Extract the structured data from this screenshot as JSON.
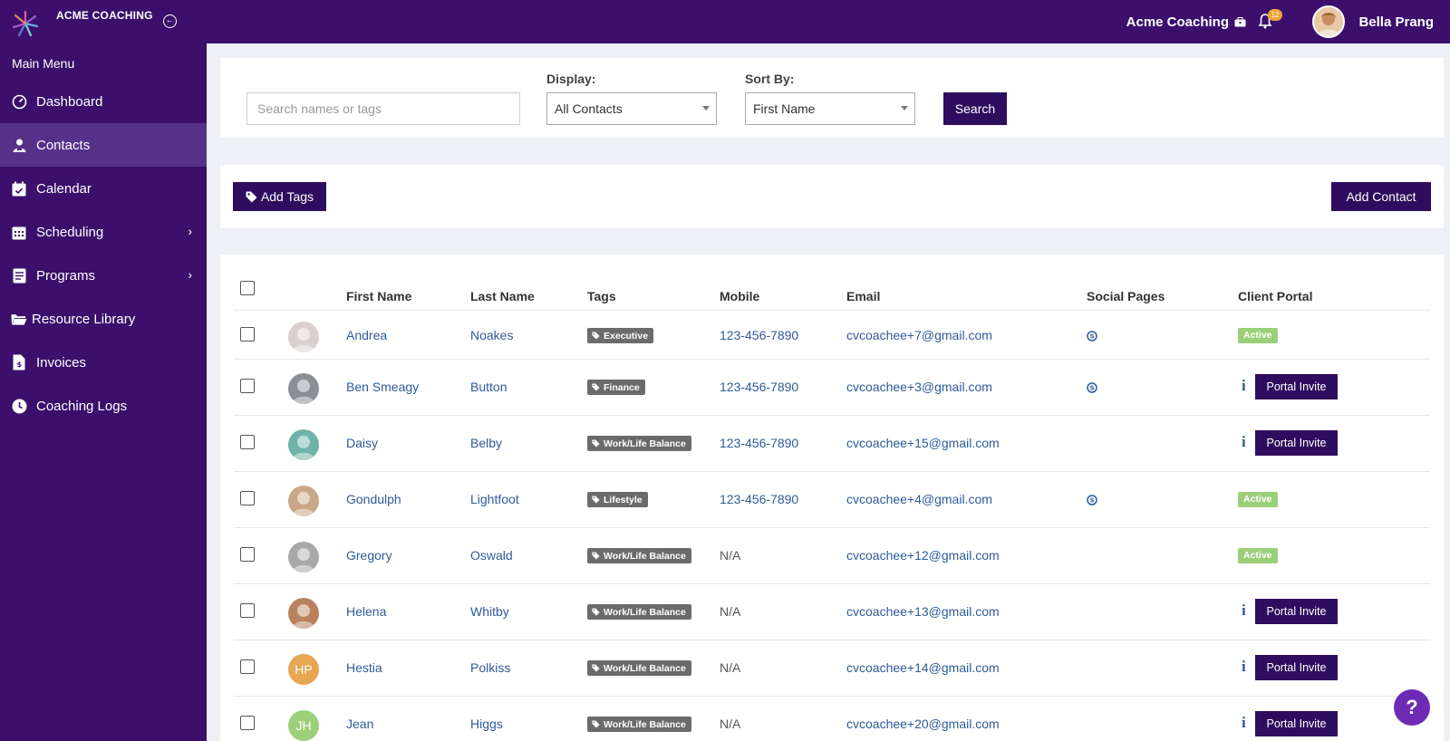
{
  "topbar": {
    "brand": "ACME COACHING",
    "org": "Acme Coaching",
    "notifications": "12",
    "user": "Bella Prang"
  },
  "sidebar": {
    "title": "Main Menu",
    "items": [
      {
        "label": "Dashboard",
        "icon": "dashboard-icon"
      },
      {
        "label": "Contacts",
        "icon": "contacts-icon",
        "active": true
      },
      {
        "label": "Calendar",
        "icon": "calendar-icon"
      },
      {
        "label": "Scheduling",
        "icon": "scheduling-icon",
        "submenu": true
      },
      {
        "label": "Programs",
        "icon": "programs-icon",
        "submenu": true
      },
      {
        "label": "Resource Library",
        "icon": "folder-icon"
      },
      {
        "label": "Invoices",
        "icon": "invoice-icon"
      },
      {
        "label": "Coaching Logs",
        "icon": "clock-icon"
      }
    ]
  },
  "filters": {
    "search_placeholder": "Search names or tags",
    "display_label": "Display:",
    "display_value": "All Contacts",
    "sort_label": "Sort By:",
    "sort_value": "First Name",
    "search_button": "Search"
  },
  "actions": {
    "add_tags": "Add Tags",
    "add_contact": "Add Contact"
  },
  "table": {
    "headers": [
      "First Name",
      "Last Name",
      "Tags",
      "Mobile",
      "Email",
      "Social Pages",
      "Client Portal"
    ],
    "portal_invite": "Portal Invite",
    "active_label": "Active",
    "rows": [
      {
        "first": "Andrea",
        "last": "Noakes",
        "tag": "Executive",
        "mobile": "123-456-7890",
        "email": "cvcoachee+7@gmail.com",
        "skype": true,
        "portal": "active",
        "avatar_color": "#d9d1cf"
      },
      {
        "first": "Ben Smeagy",
        "last": "Button",
        "tag": "Finance",
        "mobile": "123-456-7890",
        "email": "cvcoachee+3@gmail.com",
        "skype": true,
        "portal": "invite",
        "avatar_color": "#8a8f96"
      },
      {
        "first": "Daisy",
        "last": "Belby",
        "tag": "Work/Life Balance",
        "mobile": "123-456-7890",
        "email": "cvcoachee+15@gmail.com",
        "skype": false,
        "portal": "invite",
        "avatar_color": "#6fb3a8"
      },
      {
        "first": "Gondulph",
        "last": "Lightfoot",
        "tag": "Lifestyle",
        "mobile": "123-456-7890",
        "email": "cvcoachee+4@gmail.com",
        "skype": true,
        "portal": "active",
        "avatar_color": "#c9a887"
      },
      {
        "first": "Gregory",
        "last": "Oswald",
        "tag": "Work/Life Balance",
        "mobile": "N/A",
        "email": "cvcoachee+12@gmail.com",
        "skype": false,
        "portal": "active",
        "avatar_color": "#a8a8a8"
      },
      {
        "first": "Helena",
        "last": "Whitby",
        "tag": "Work/Life Balance",
        "mobile": "N/A",
        "email": "cvcoachee+13@gmail.com",
        "skype": false,
        "portal": "invite",
        "avatar_color": "#b9825d"
      },
      {
        "first": "Hestia",
        "last": "Polkiss",
        "tag": "Work/Life Balance",
        "mobile": "N/A",
        "email": "cvcoachee+14@gmail.com",
        "skype": false,
        "portal": "invite",
        "avatar_initials": "HP",
        "avatar_color": "#e8a552"
      },
      {
        "first": "Jean",
        "last": "Higgs",
        "tag": "Work/Life Balance",
        "mobile": "N/A",
        "email": "cvcoachee+20@gmail.com",
        "skype": false,
        "portal": "invite",
        "avatar_initials": "JH",
        "avatar_color": "#9ccf7a"
      }
    ]
  },
  "help_label": "?"
}
